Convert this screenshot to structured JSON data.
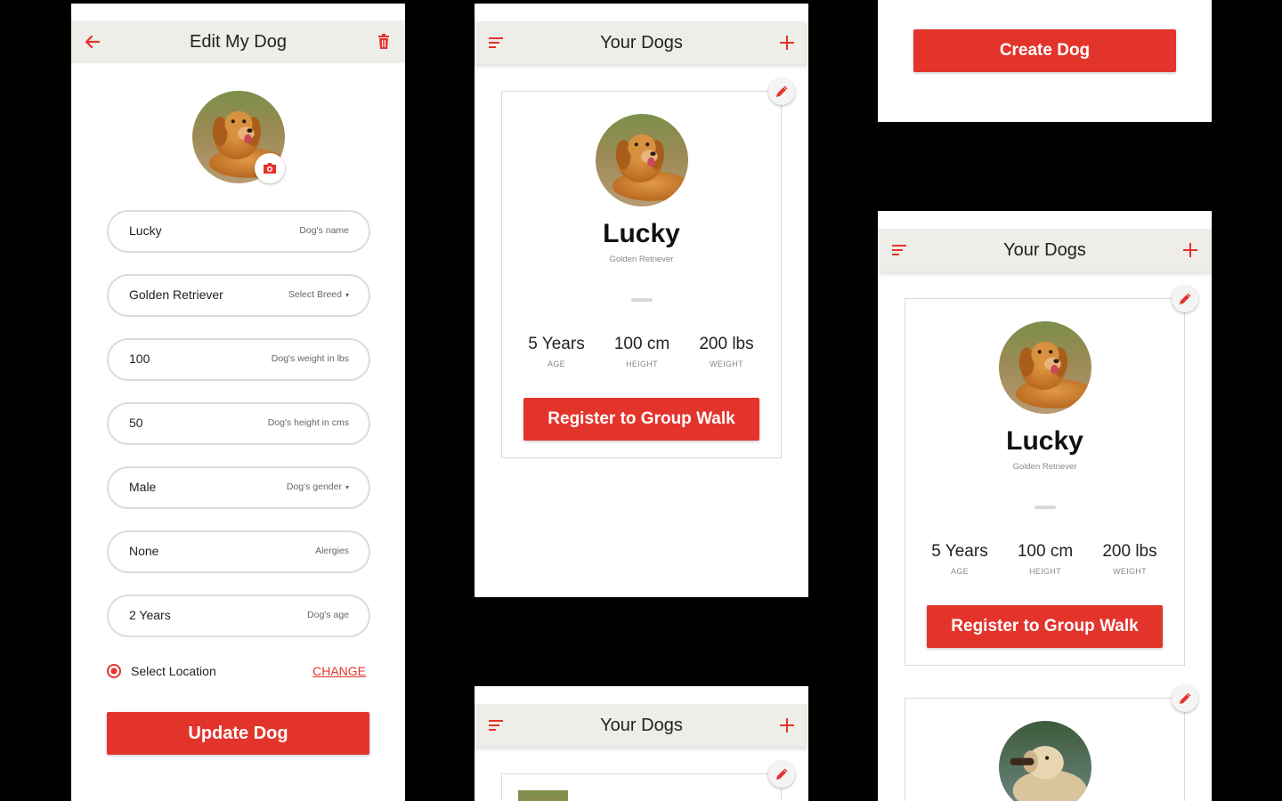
{
  "edit_screen": {
    "title": "Edit My Dog",
    "fields": [
      {
        "value": "Lucky",
        "placeholder": "Dog's name",
        "dropdown": false
      },
      {
        "value": "Golden Retriever",
        "placeholder": "Select Breed",
        "dropdown": true
      },
      {
        "value": "100",
        "placeholder": "Dog's weight in lbs",
        "dropdown": false
      },
      {
        "value": "50",
        "placeholder": "Dog's height in cms",
        "dropdown": false
      },
      {
        "value": "Male",
        "placeholder": "Dog's gender",
        "dropdown": true
      },
      {
        "value": "None",
        "placeholder": "Alergies",
        "dropdown": false
      },
      {
        "value": "2 Years",
        "placeholder": "Dog's age",
        "dropdown": false
      }
    ],
    "location_label": "Select Location",
    "change_link": "CHANGE",
    "submit_label": "Update Dog"
  },
  "your_dogs": {
    "title": "Your Dogs",
    "dog": {
      "name": "Lucky",
      "breed": "Golden Retriever",
      "stats": [
        {
          "value": "5 Years",
          "label": "AGE"
        },
        {
          "value": "100 cm",
          "label": "HEIGHT"
        },
        {
          "value": "200 lbs",
          "label": "WEIGHT"
        }
      ],
      "action_label": "Register to Group Walk"
    }
  },
  "create_screen": {
    "button_label": "Create Dog"
  },
  "colors": {
    "accent": "#e3342c",
    "appbar": "#efede8",
    "field_border": "#dcdcdc"
  },
  "icons": [
    "back-arrow-icon",
    "trash-icon",
    "camera-icon",
    "menu-icon",
    "plus-icon",
    "pencil-icon",
    "radio-icon"
  ]
}
